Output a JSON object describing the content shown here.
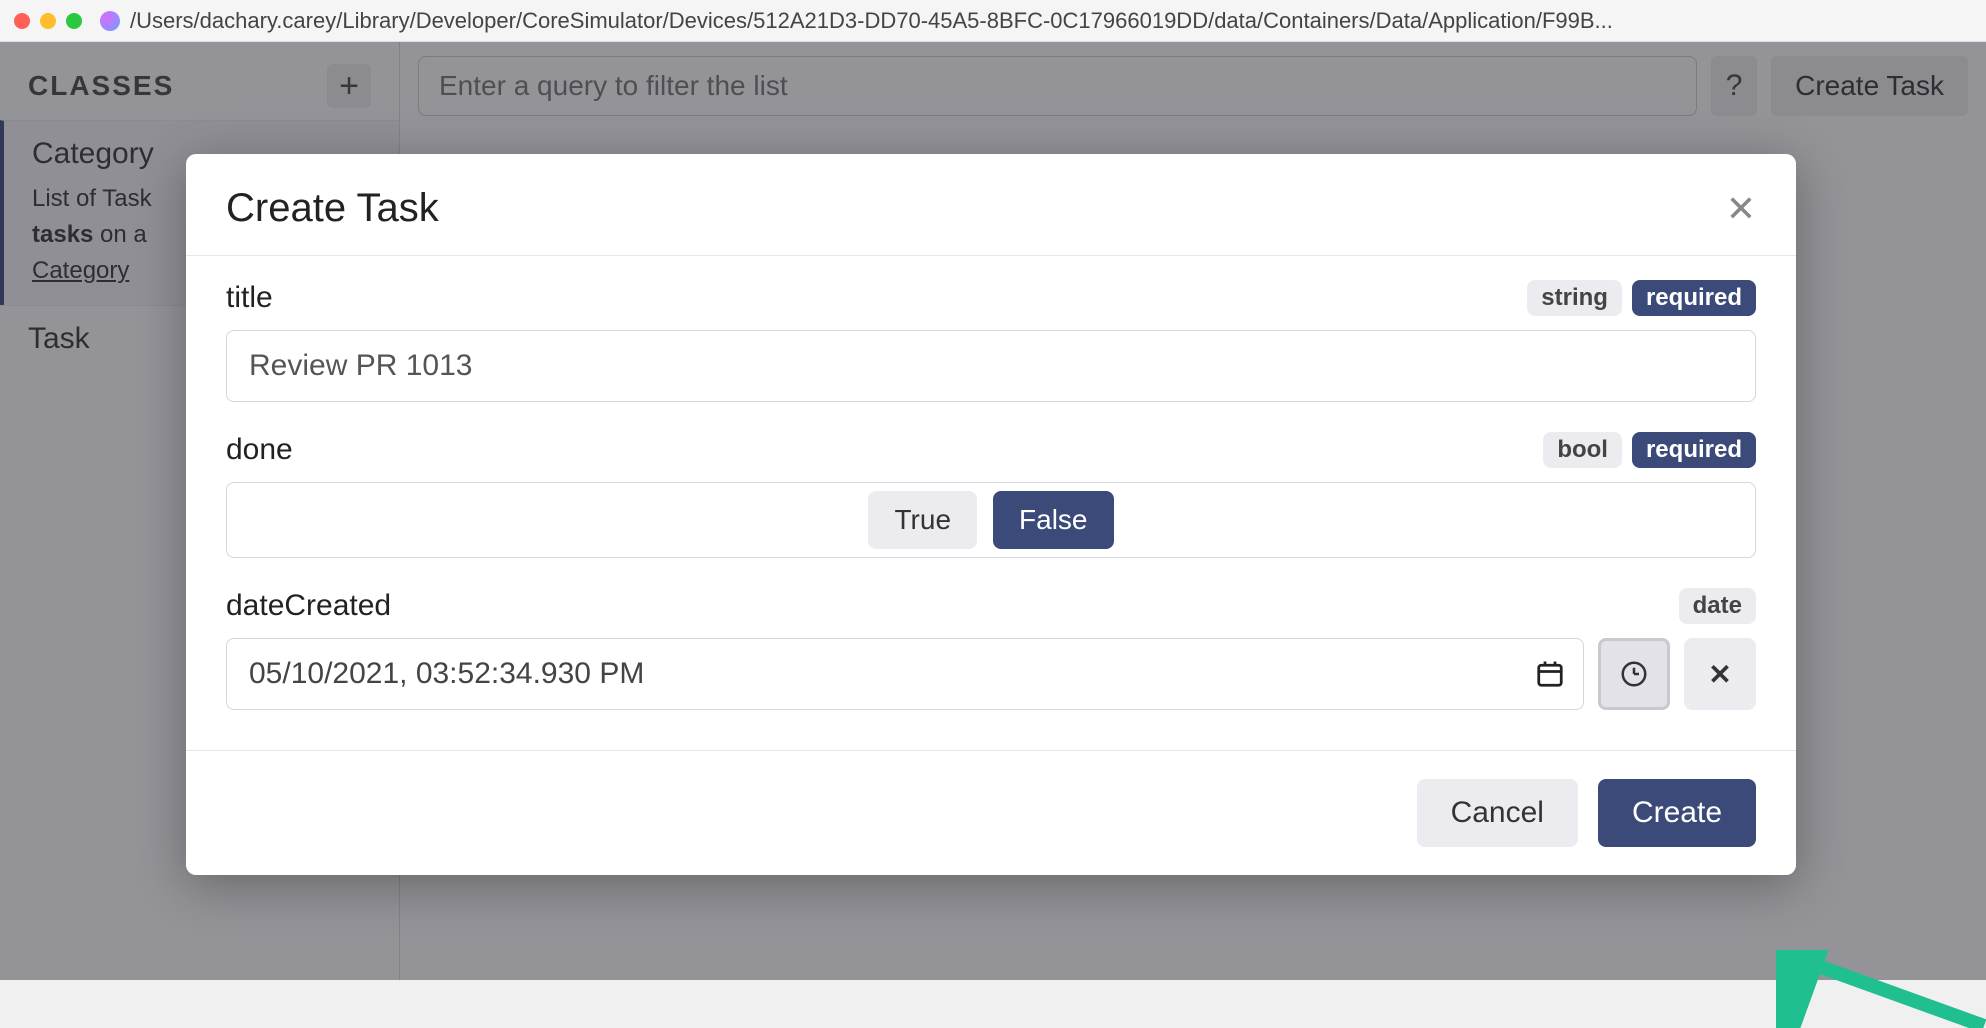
{
  "window": {
    "path": "/Users/dachary.carey/Library/Developer/CoreSimulator/Devices/512A21D3-DD70-45A5-8BFC-0C17966019DD/data/Containers/Data/Application/F99B..."
  },
  "sidebar": {
    "title": "CLASSES",
    "items": [
      {
        "name": "Category",
        "desc_prefix": "List of Task",
        "desc_bold": "tasks",
        "desc_mid": " on a",
        "desc_link": "Category"
      },
      {
        "name": "Task"
      }
    ]
  },
  "toolbar": {
    "query_placeholder": "Enter a query to filter the list",
    "help": "?",
    "create_task": "Create Task"
  },
  "modal": {
    "title": "Create Task",
    "fields": {
      "title": {
        "label": "title",
        "type": "string",
        "required": "required",
        "value": "Review PR 1013"
      },
      "done": {
        "label": "done",
        "type": "bool",
        "required": "required",
        "true_label": "True",
        "false_label": "False"
      },
      "dateCreated": {
        "label": "dateCreated",
        "type": "date",
        "value": "05/10/2021, 03:52:34.930 PM"
      }
    },
    "cancel": "Cancel",
    "create": "Create"
  }
}
